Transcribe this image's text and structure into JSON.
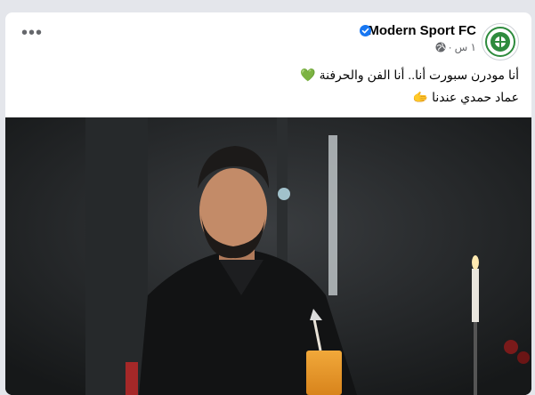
{
  "post": {
    "page_name": "Modern Sport FC",
    "time": "١ س",
    "separator": "·",
    "line1": "أنا مودرن سبورت أنا.. أنا الفن والحرفنة 💚",
    "line2": "عماد حمدي عندنا 🫱"
  },
  "icons": {
    "avatar": "modern-sport-logo",
    "verified": "verified-badge-icon",
    "audience": "globe-icon",
    "more": "more-options-icon"
  },
  "colors": {
    "verified": "#1877f2",
    "logo_green": "#2e8b3d"
  }
}
